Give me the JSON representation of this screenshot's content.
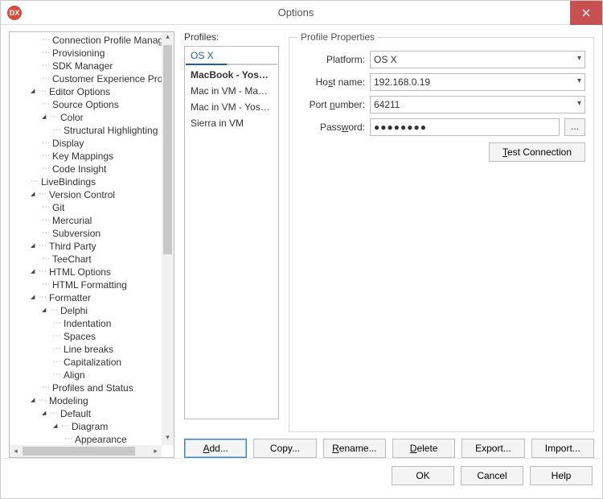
{
  "window": {
    "title": "Options",
    "icon_text": "DX"
  },
  "tree": [
    {
      "indent": 2,
      "arrow": "",
      "label": "Connection Profile Manager"
    },
    {
      "indent": 2,
      "arrow": "",
      "label": "Provisioning"
    },
    {
      "indent": 2,
      "arrow": "",
      "label": "SDK Manager"
    },
    {
      "indent": 2,
      "arrow": "",
      "label": "Customer Experience Program"
    },
    {
      "indent": 1,
      "arrow": "▴",
      "label": "Editor Options"
    },
    {
      "indent": 2,
      "arrow": "",
      "label": "Source Options"
    },
    {
      "indent": 2,
      "arrow": "▴",
      "label": "Color"
    },
    {
      "indent": 3,
      "arrow": "",
      "label": "Structural Highlighting"
    },
    {
      "indent": 2,
      "arrow": "",
      "label": "Display"
    },
    {
      "indent": 2,
      "arrow": "",
      "label": "Key Mappings"
    },
    {
      "indent": 2,
      "arrow": "",
      "label": "Code Insight"
    },
    {
      "indent": 1,
      "arrow": "",
      "label": "LiveBindings"
    },
    {
      "indent": 1,
      "arrow": "▴",
      "label": "Version Control"
    },
    {
      "indent": 2,
      "arrow": "",
      "label": "Git"
    },
    {
      "indent": 2,
      "arrow": "",
      "label": "Mercurial"
    },
    {
      "indent": 2,
      "arrow": "",
      "label": "Subversion"
    },
    {
      "indent": 1,
      "arrow": "▴",
      "label": "Third Party"
    },
    {
      "indent": 2,
      "arrow": "",
      "label": "TeeChart"
    },
    {
      "indent": 1,
      "arrow": "▴",
      "label": "HTML Options"
    },
    {
      "indent": 2,
      "arrow": "",
      "label": "HTML Formatting"
    },
    {
      "indent": 1,
      "arrow": "▴",
      "label": "Formatter"
    },
    {
      "indent": 2,
      "arrow": "▴",
      "label": "Delphi"
    },
    {
      "indent": 3,
      "arrow": "",
      "label": "Indentation"
    },
    {
      "indent": 3,
      "arrow": "",
      "label": "Spaces"
    },
    {
      "indent": 3,
      "arrow": "",
      "label": "Line breaks"
    },
    {
      "indent": 3,
      "arrow": "",
      "label": "Capitalization"
    },
    {
      "indent": 3,
      "arrow": "",
      "label": "Align"
    },
    {
      "indent": 2,
      "arrow": "",
      "label": "Profiles and Status"
    },
    {
      "indent": 1,
      "arrow": "▴",
      "label": "Modeling"
    },
    {
      "indent": 2,
      "arrow": "▴",
      "label": "Default"
    },
    {
      "indent": 3,
      "arrow": "▴",
      "label": "Diagram"
    },
    {
      "indent": 4,
      "arrow": "",
      "label": "Appearance"
    }
  ],
  "profiles": {
    "label": "Profiles:",
    "tab": "OS X",
    "items": [
      {
        "label": "MacBook - Yos…",
        "active": true
      },
      {
        "label": "Mac in VM - Mave…",
        "active": false
      },
      {
        "label": "Mac in VM - Yose…",
        "active": false
      },
      {
        "label": "Sierra in VM",
        "active": false
      }
    ]
  },
  "properties": {
    "legend": "Profile Properties",
    "platform_label": "Platform:",
    "platform_value": "OS X",
    "hostname_label_pre": "Ho",
    "hostname_label_u": "s",
    "hostname_label_post": "t name:",
    "hostname_value": "192.168.0.19",
    "port_label_pre": "Port ",
    "port_label_u": "n",
    "port_label_post": "umber:",
    "port_value": "64211",
    "password_label_pre": "Pass",
    "password_label_u": "w",
    "password_label_post": "ord:",
    "password_value": "●●●●●●●●",
    "ellipsis": "...",
    "test_label": "Test Connection"
  },
  "profile_buttons": {
    "add": "Add...",
    "copy": "Copy...",
    "rename": "Rename...",
    "delete": "Delete",
    "export": "Export...",
    "import": "Import..."
  },
  "footer": {
    "ok": "OK",
    "cancel": "Cancel",
    "help": "Help"
  }
}
